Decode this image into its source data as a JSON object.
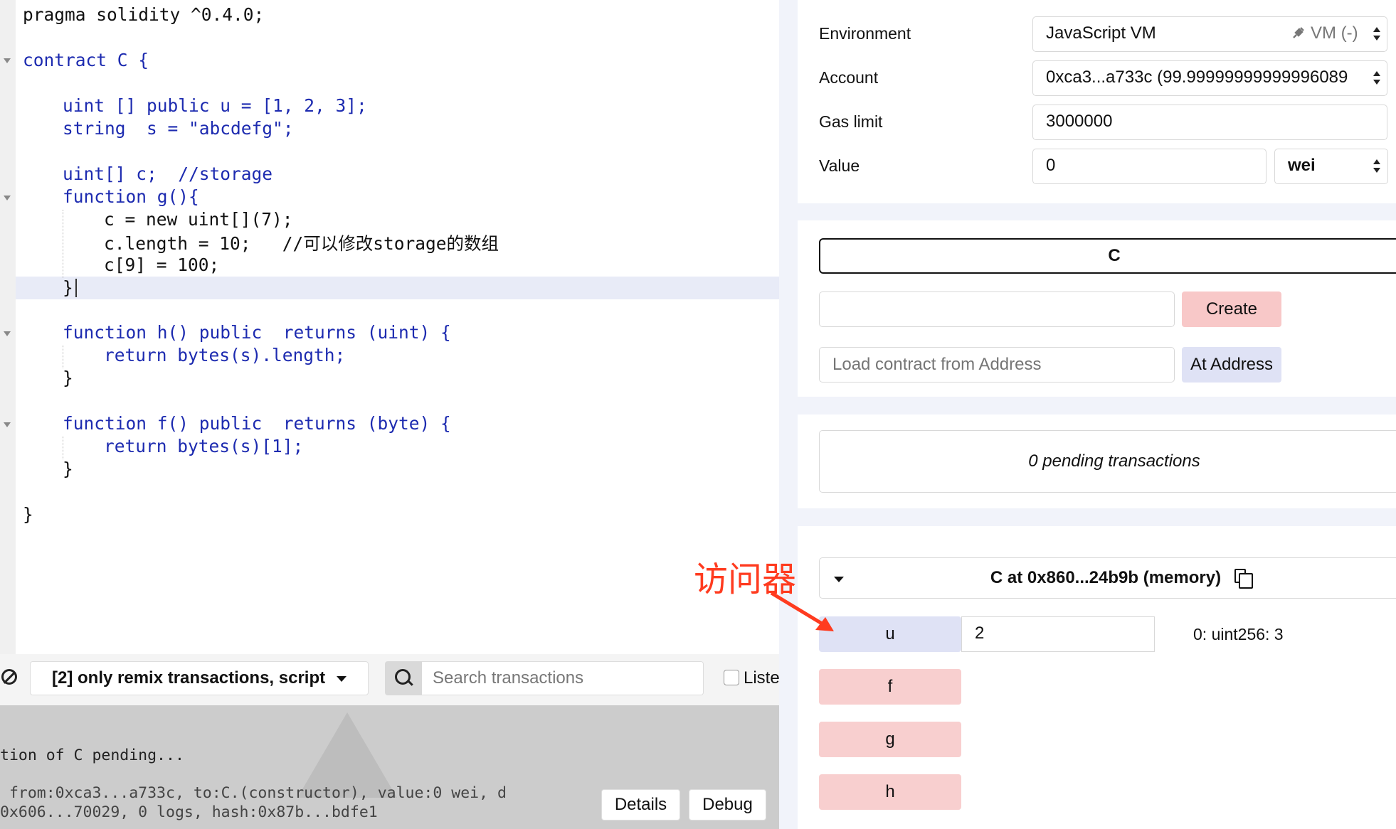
{
  "editor": {
    "lines": [
      "pragma solidity ^0.4.0;",
      "contract C {",
      "uint [] public u = [1, 2, 3];",
      "string  s = \"abcdefg\";",
      "uint[] c;  //storage",
      "function g(){",
      "c = new uint[](7);",
      "c.length = 10;   //可以修改storage的数组",
      "c[9] = 100;",
      "}",
      "function h() public  returns (uint) {",
      "return bytes(s).length;",
      "}",
      "function f() public  returns (byte) {",
      "return bytes(s)[1];",
      "}",
      "}"
    ]
  },
  "terminal": {
    "filter_label": "[2] only remix transactions, script",
    "search_placeholder": "Search transactions",
    "listen_label": "Listen on network",
    "log_line_pending": "tion of C pending...",
    "log_line_from": " from:0xca3...a733c, to:C.(constructor), value:0 wei, d",
    "log_line_hash": "0x606...70029, 0 logs, hash:0x87b...bdfe1",
    "details_label": "Details",
    "debug_label": "Debug"
  },
  "run": {
    "environment_label": "Environment",
    "environment_value": "JavaScript VM",
    "vm_badge": "VM (-)",
    "account_label": "Account",
    "account_value": "0xca3...a733c (99.99999999999996089",
    "gas_label": "Gas limit",
    "gas_value": "3000000",
    "value_label": "Value",
    "value_value": "0",
    "unit_value": "wei",
    "contract_select": "C",
    "create_label": "Create",
    "at_address_label": "At Address",
    "load_placeholder": "Load contract from Address",
    "pending": "0 pending transactions",
    "instance_title": "C at 0x860...24b9b (memory)",
    "func_u": "u",
    "func_u_arg": "2",
    "func_u_result": "0: uint256: 3",
    "func_f": "f",
    "func_g": "g",
    "func_h": "h"
  },
  "annotation": {
    "text": "访问器",
    "color": "#ff3b1f"
  }
}
